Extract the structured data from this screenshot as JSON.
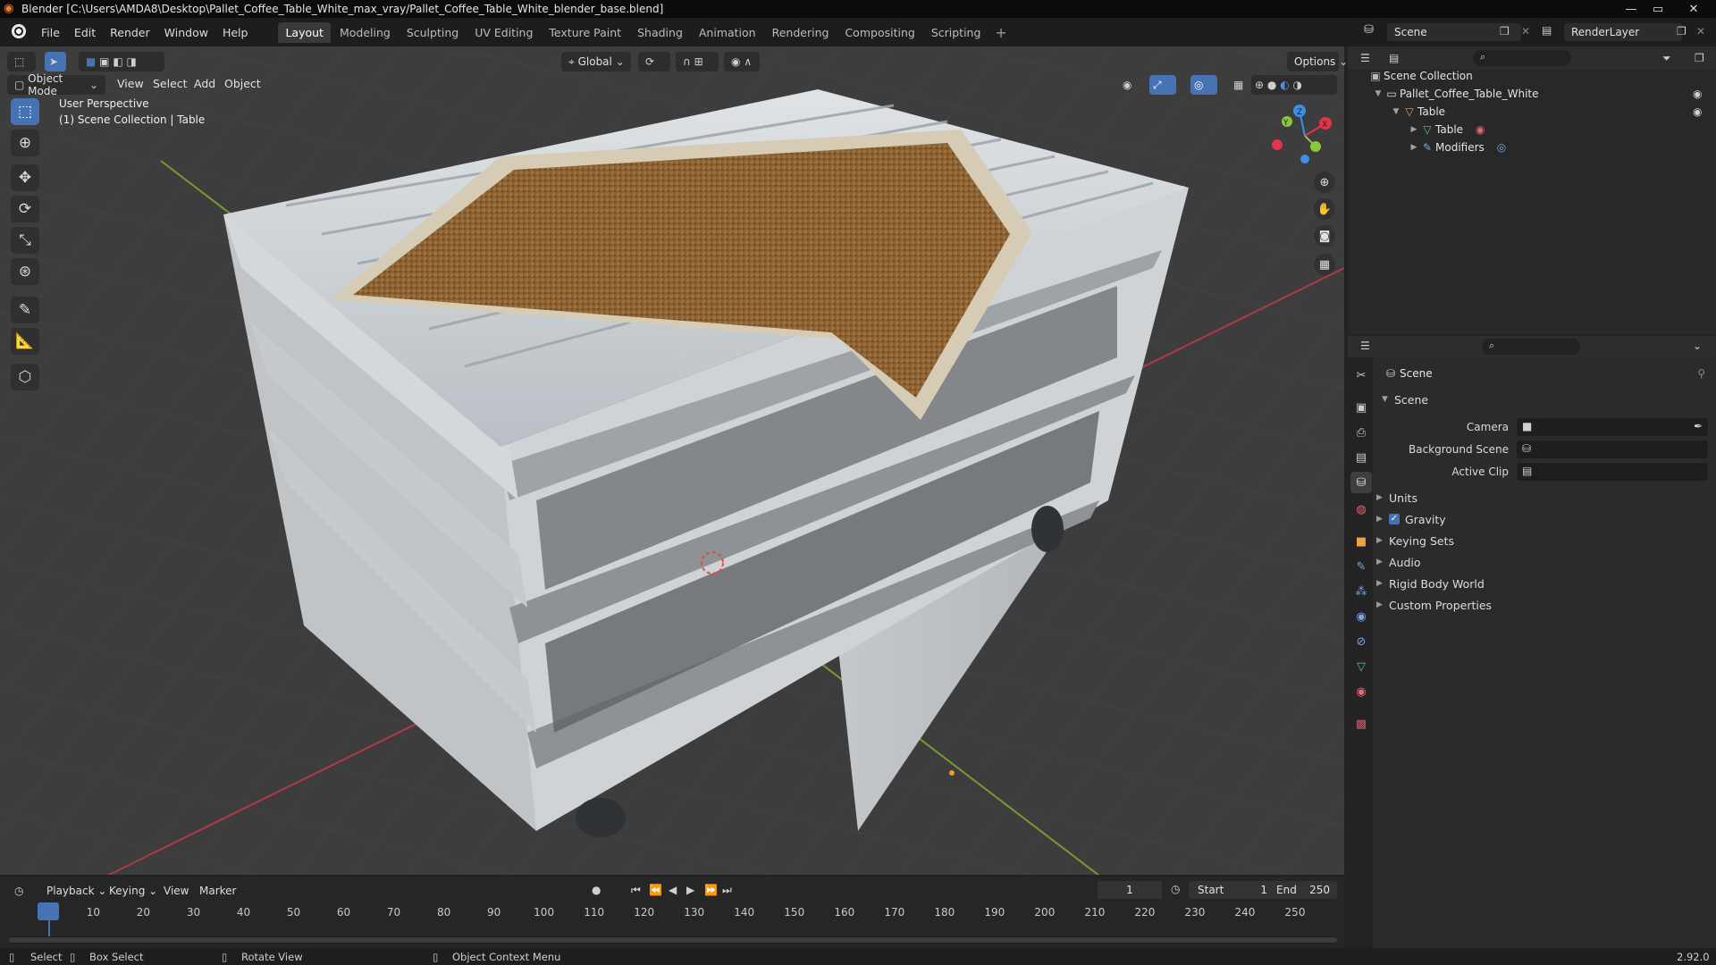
{
  "window": {
    "title": "Blender [C:\\Users\\AMDA8\\Desktop\\Pallet_Coffee_Table_White_max_vray/Pallet_Coffee_Table_White_blender_base.blend]"
  },
  "menu": {
    "items": [
      "File",
      "Edit",
      "Render",
      "Window",
      "Help"
    ],
    "workspaces": [
      "Layout",
      "Modeling",
      "Sculpting",
      "UV Editing",
      "Texture Paint",
      "Shading",
      "Animation",
      "Rendering",
      "Compositing",
      "Scripting"
    ],
    "active_workspace": "Layout",
    "add_tab": "+",
    "scene_name": "Scene",
    "view_layer": "RenderLayer"
  },
  "viewport_header": {
    "mode": "Object Mode",
    "menus": [
      "View",
      "Select",
      "Add",
      "Object"
    ],
    "transform_orientation": "Global",
    "options_label": "Options"
  },
  "viewport": {
    "perspective_label": "User Perspective",
    "collection_label": "(1) Scene Collection | Table",
    "gizmo": {
      "x": "X",
      "y": "Y",
      "z": "Z"
    }
  },
  "tools": [
    "select-box",
    "cursor",
    "move",
    "rotate",
    "scale",
    "transform",
    "annotate",
    "measure",
    "add-cube"
  ],
  "outliner": {
    "root": "Scene Collection",
    "items": [
      {
        "label": "Pallet_Coffee_Table_White",
        "depth": 1,
        "expanded": true
      },
      {
        "label": "Table",
        "depth": 2,
        "expanded": true
      },
      {
        "label": "Table",
        "depth": 3,
        "expanded": false
      },
      {
        "label": "Modifiers",
        "depth": 3,
        "expanded": false
      }
    ]
  },
  "properties": {
    "context": "Scene",
    "panel_title": "Scene",
    "fields": [
      {
        "label": "Camera",
        "value": ""
      },
      {
        "label": "Background Scene",
        "value": ""
      },
      {
        "label": "Active Clip",
        "value": ""
      }
    ],
    "panels": [
      "Units",
      "Gravity",
      "Keying Sets",
      "Audio",
      "Rigid Body World",
      "Custom Properties"
    ],
    "gravity_checked": true
  },
  "timeline": {
    "menus": [
      "Playback",
      "Keying",
      "View",
      "Marker"
    ],
    "current_frame": "1",
    "start_label": "Start",
    "start": "1",
    "end_label": "End",
    "end": "250",
    "ticks": [
      "1",
      "10",
      "20",
      "30",
      "40",
      "50",
      "60",
      "70",
      "80",
      "90",
      "100",
      "110",
      "120",
      "130",
      "140",
      "150",
      "160",
      "170",
      "180",
      "190",
      "200",
      "210",
      "220",
      "230",
      "240",
      "250"
    ]
  },
  "statusbar": {
    "select": "Select",
    "box_select": "Box Select",
    "rotate_view": "Rotate View",
    "context_menu": "Object Context Menu",
    "version": "2.92.0"
  },
  "colors": {
    "accent": "#4772b3",
    "gizmo_x": "#e3344d",
    "gizmo_y": "#8cc63e",
    "gizmo_z": "#3f8fe8"
  }
}
